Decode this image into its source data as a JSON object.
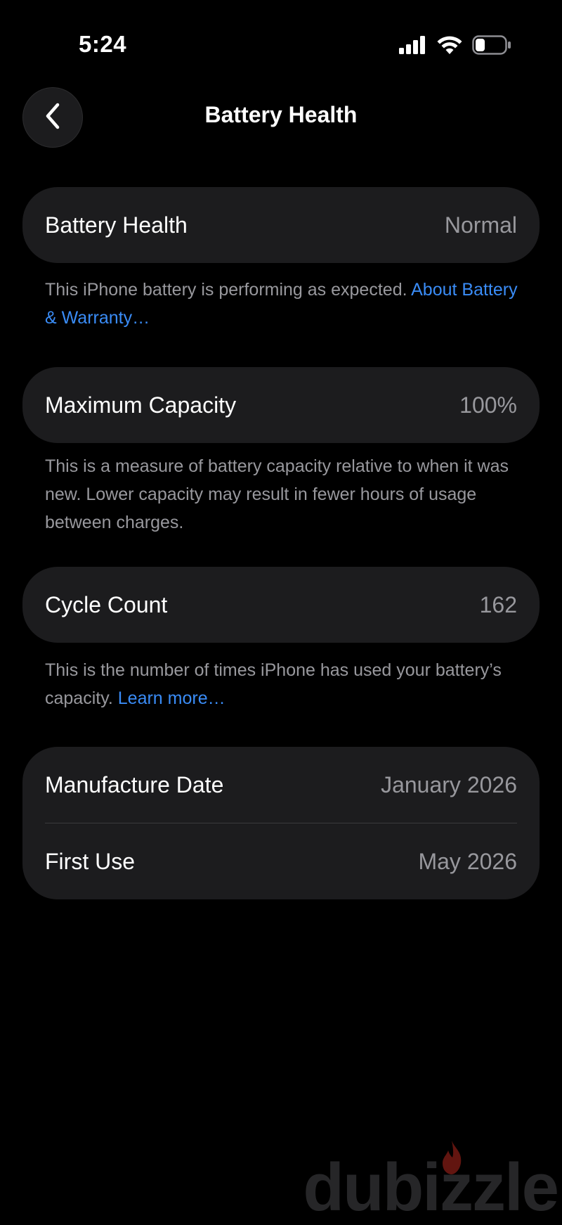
{
  "status_bar": {
    "time": "5:24"
  },
  "nav": {
    "title": "Battery Health"
  },
  "battery_health": {
    "label": "Battery Health",
    "value": "Normal",
    "note": "This iPhone battery is performing as expected.",
    "note_link": "About Battery & Warranty…"
  },
  "maximum_capacity": {
    "label": "Maximum Capacity",
    "value": "100%",
    "note": "This is a measure of battery capacity relative to when it was new. Lower capacity may result in fewer hours of usage between charges."
  },
  "cycle_count": {
    "label": "Cycle Count",
    "value": "162",
    "note": "This is the number of times iPhone has used your battery’s capacity.",
    "note_link": "Learn more…"
  },
  "dates": {
    "manufacture_label": "Manufacture Date",
    "manufacture_value": "January 2026",
    "first_use_label": "First Use",
    "first_use_value": "May 2026"
  },
  "watermark": {
    "text": "dubizzle"
  },
  "colors": {
    "background": "#000000",
    "card": "#1c1c1e",
    "secondary_text": "#98989d",
    "link": "#3a8cf6"
  },
  "icons": {
    "back": "chevron-left-icon",
    "signal": "cellular-signal-icon",
    "wifi": "wifi-icon",
    "battery": "battery-icon"
  }
}
